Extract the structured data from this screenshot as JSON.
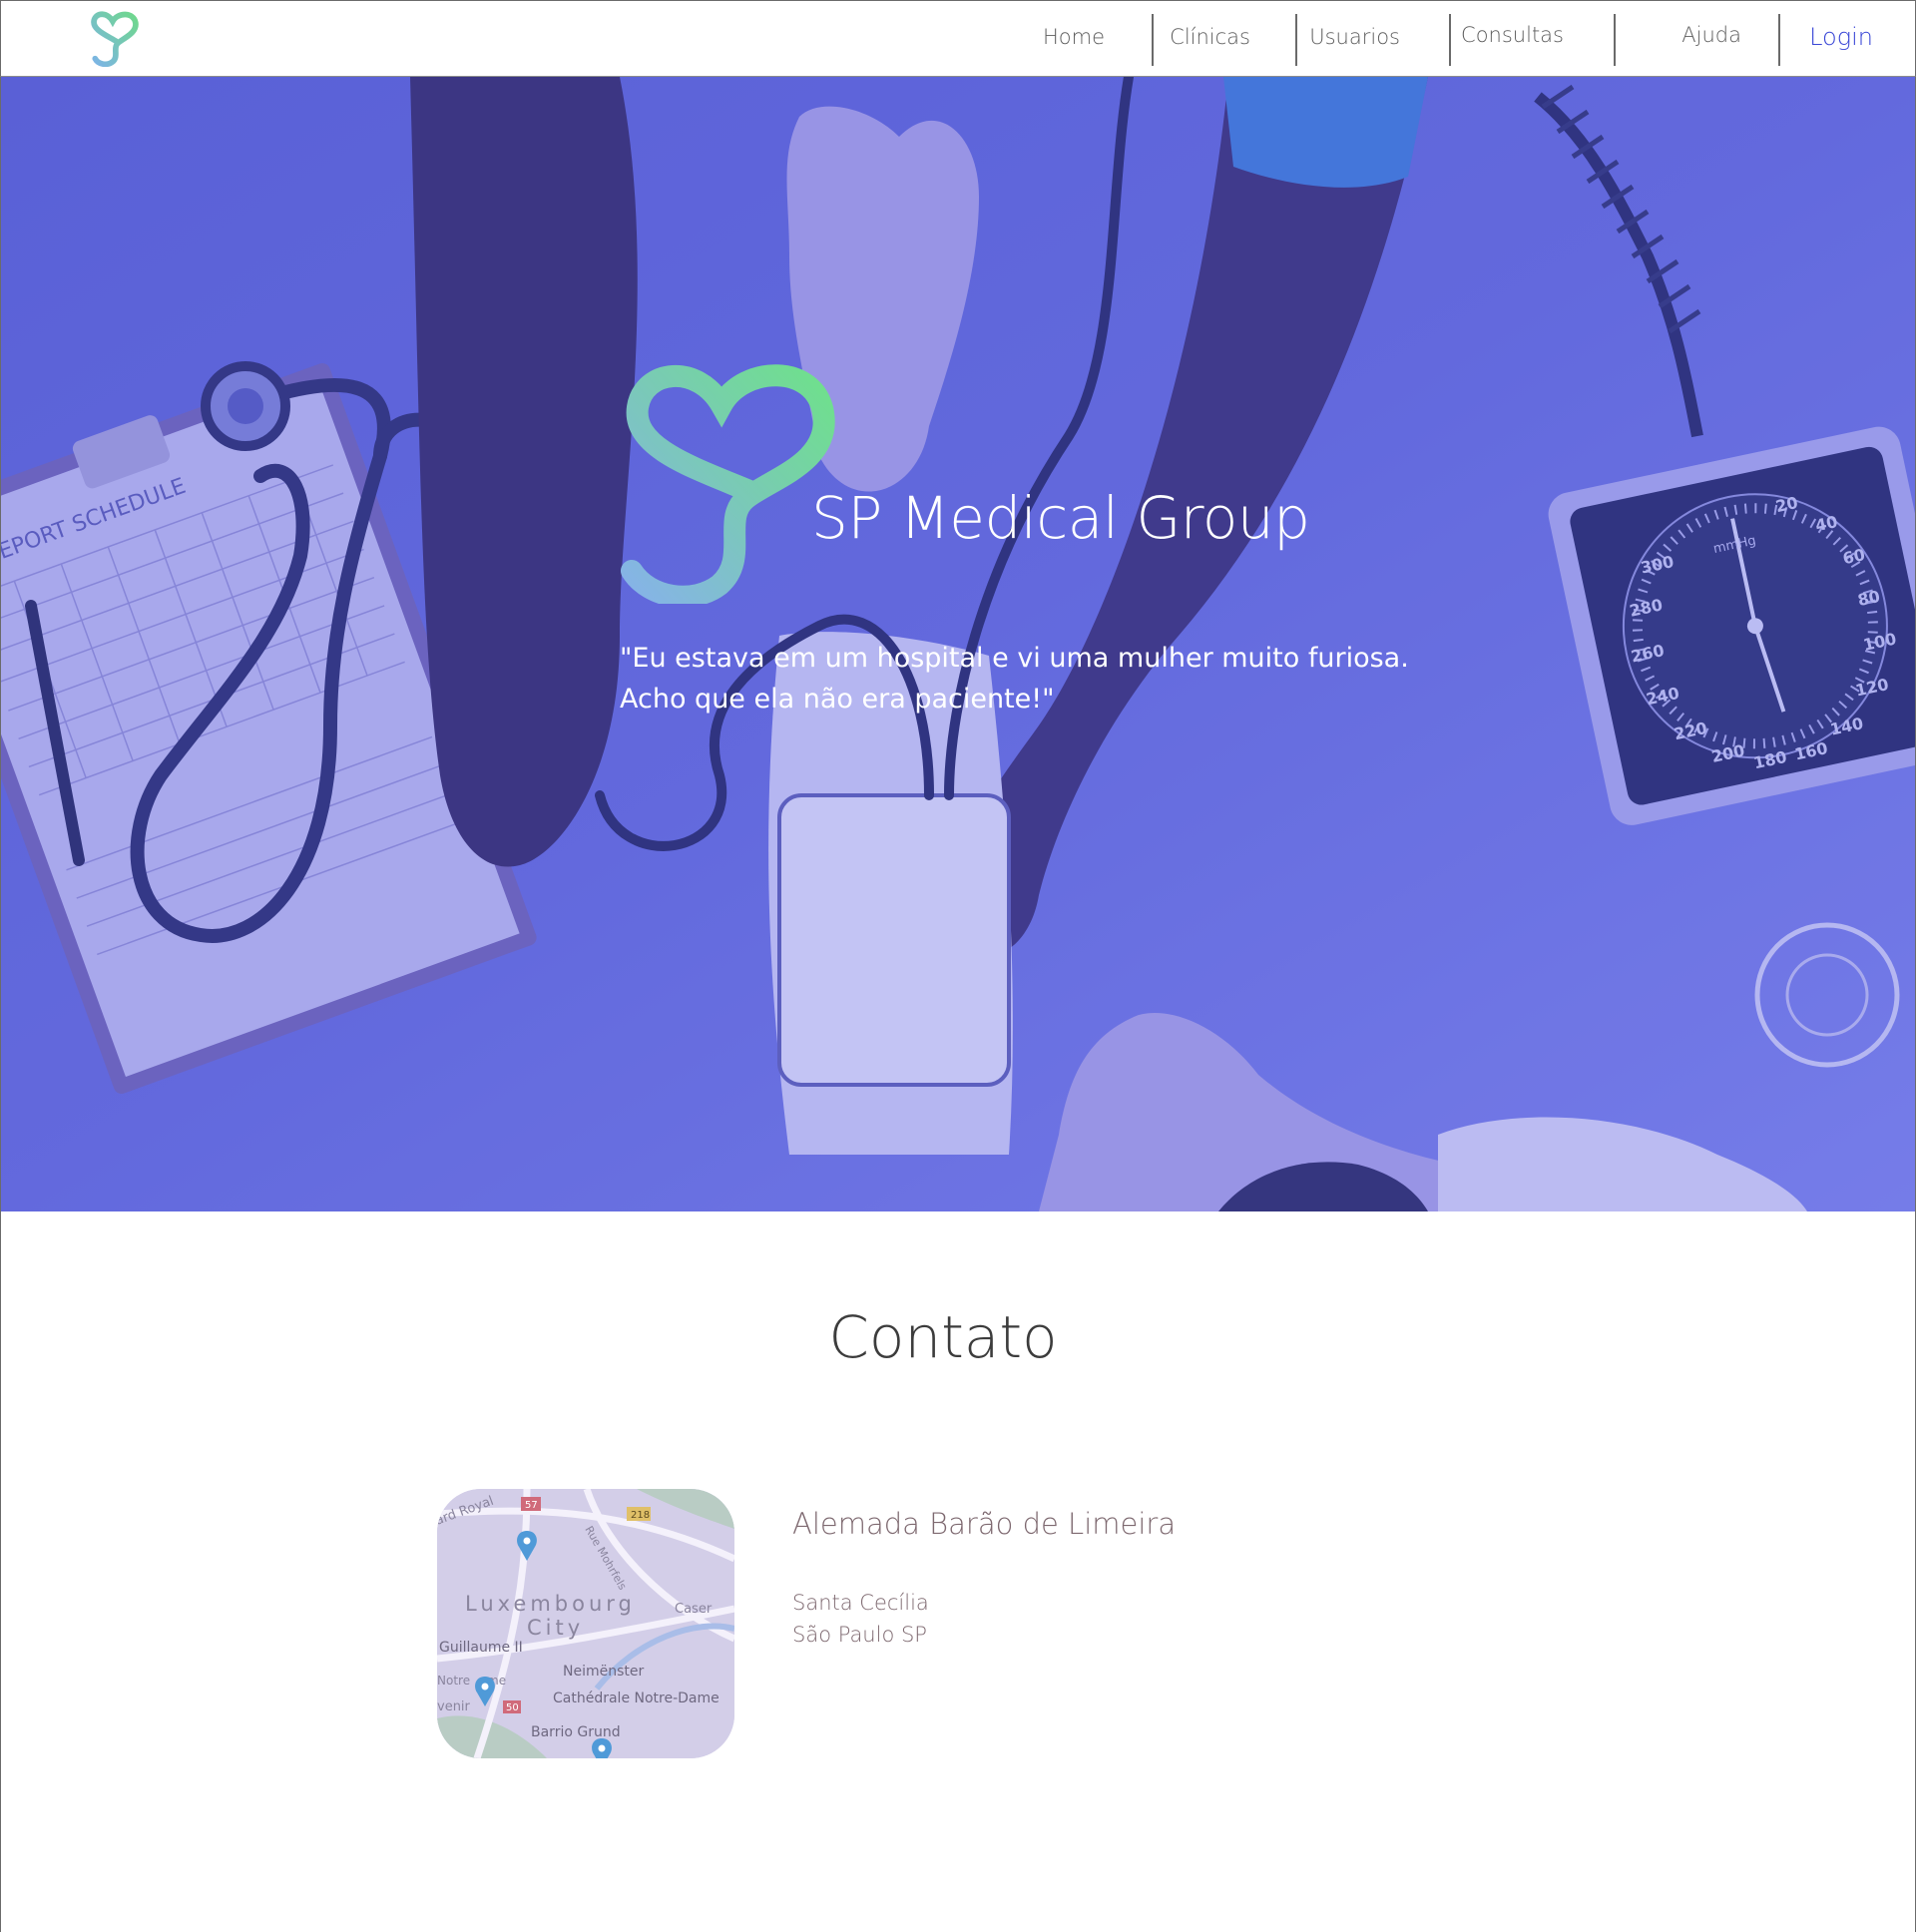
{
  "header": {
    "nav": [
      {
        "label": "Home"
      },
      {
        "label": "Clínicas"
      },
      {
        "label": "Usuarios"
      },
      {
        "label": "Consultas"
      },
      {
        "label": "Ajuda"
      }
    ],
    "login_label": "Login"
  },
  "hero": {
    "title": "SP Medical Group",
    "quote_line1": "\"Eu estava em um hospital e vi uma mulher muito furiosa.",
    "quote_line2": "Acho que ela não era paciente!\"",
    "clipboard_text": "Y REPORT SCHEDULE",
    "gauge_unit": "mmHg",
    "gauge_ticks": [
      "300",
      "280",
      "260",
      "240",
      "220",
      "200",
      "180",
      "160",
      "140",
      "120",
      "100",
      "80",
      "60",
      "40",
      "20"
    ]
  },
  "contact": {
    "title": "Contato",
    "street": "Alemada Barão de Limeira",
    "district": "Santa Cecília",
    "city": "São Paulo  SP",
    "map_labels": {
      "road_royal": "ard Royal",
      "road_57": "57",
      "road_218": "218",
      "road_mohrfels": "Rue Mohrfels",
      "city1": "Luxembourg",
      "city2": "City",
      "caser": "Caser",
      "guillaume": "Guillaume II",
      "notre": "Notre",
      "me": "me",
      "neimenster": "Neimënster",
      "venir": "venir",
      "road_50": "50",
      "cathedral": "Cathédrale Notre-Dame",
      "barrio": "Barrio Grund"
    }
  },
  "colors": {
    "brand_blue": "#5b61d6",
    "logo_blue": "#7cb4e6",
    "logo_green": "#6fd88c",
    "login_blue": "#3a47d6"
  }
}
